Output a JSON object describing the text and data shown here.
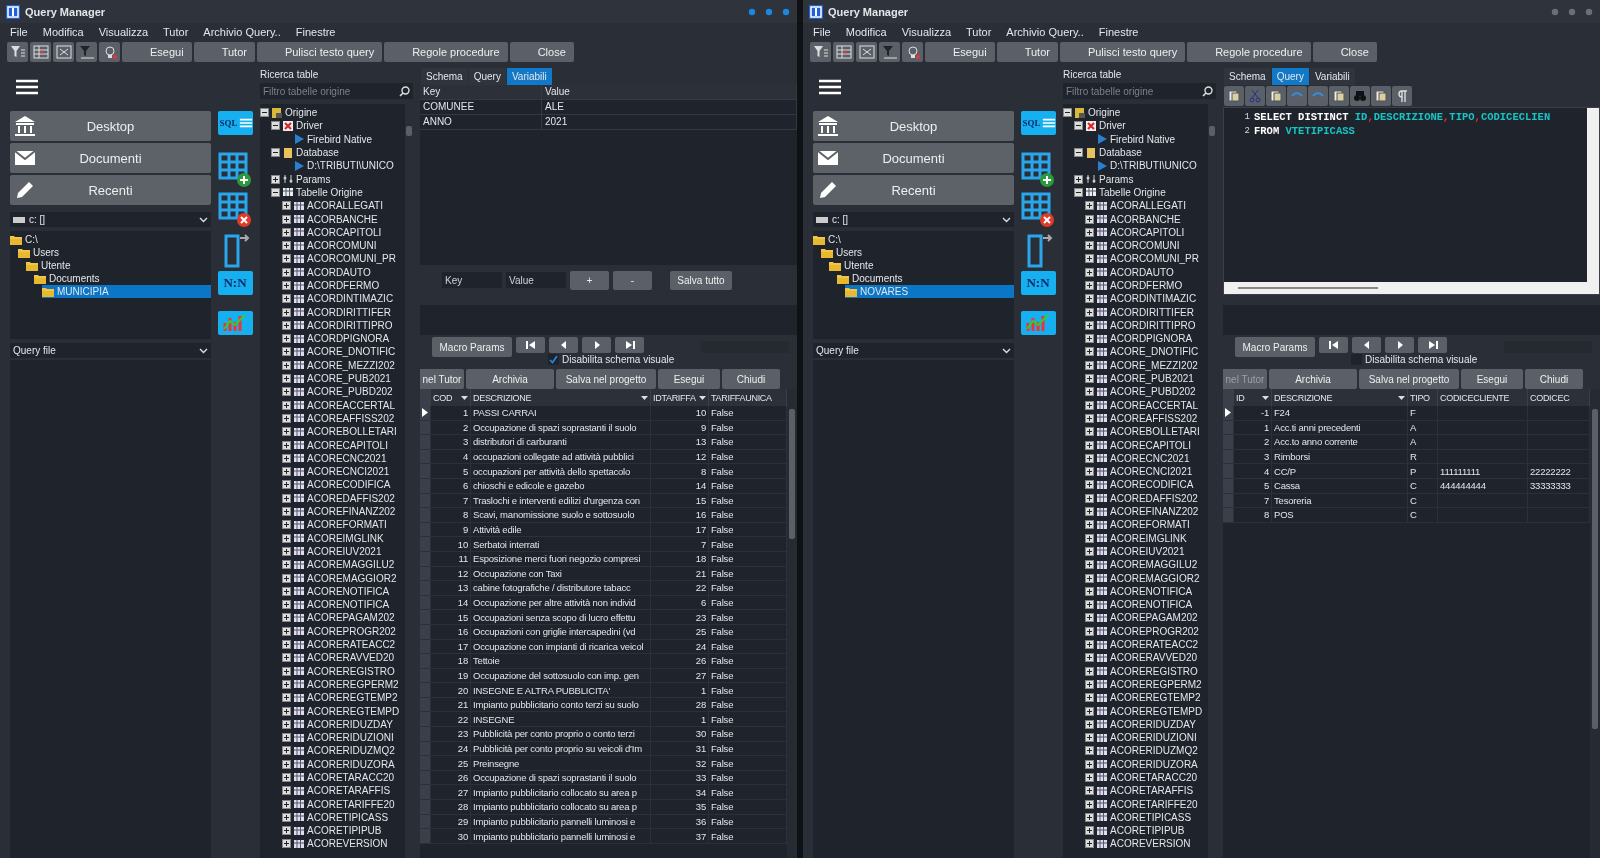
{
  "windows": [
    {
      "title": "Query Manager",
      "active": true,
      "menu": [
        "File",
        "Modifica",
        "Visualizza",
        "Tutor",
        "Archivio Query..",
        "Finestre"
      ],
      "toolbar": [
        {
          "kind": "icon"
        },
        {
          "kind": "icon"
        },
        {
          "kind": "icon"
        },
        {
          "kind": "icon"
        },
        {
          "kind": "icon"
        },
        {
          "kind": "text",
          "label": "Esegui"
        },
        {
          "kind": "text",
          "label": "Tutor"
        },
        {
          "kind": "text",
          "label": "Pulisci testo query"
        },
        {
          "kind": "text",
          "label": "Regole procedure"
        },
        {
          "kind": "text",
          "label": "Close"
        }
      ],
      "sidebar": {
        "nav": [
          "Desktop",
          "Documenti",
          "Recenti"
        ],
        "drive": "c: []",
        "folders": [
          {
            "label": "C:\\",
            "selected": false,
            "children": [
              {
                "label": "Users",
                "selected": false,
                "children": [
                  {
                    "label": "Utente",
                    "selected": false,
                    "children": [
                      {
                        "label": "Documents",
                        "selected": false,
                        "children": [
                          {
                            "label": "MUNICIPIA",
                            "selected": true
                          }
                        ]
                      }
                    ]
                  }
                ]
              }
            ]
          }
        ],
        "query_file": "Query file"
      },
      "tools": [
        {
          "kind": "sql",
          "label": "SQL"
        },
        {
          "kind": "table-add"
        },
        {
          "kind": "table-remove"
        },
        {
          "kind": "panel"
        },
        {
          "kind": "nn",
          "label": "N:N"
        },
        {
          "kind": "chart"
        }
      ],
      "tables_panel": {
        "label": "Ricerca table",
        "search": {
          "placeholder": "Filtro tabelle origine"
        },
        "tree": [
          {
            "label": "Origine",
            "kind": "root",
            "expanded": true,
            "children": [
              {
                "label": "Driver",
                "kind": "driver",
                "expanded": true,
                "children": [
                  {
                    "label": "Firebird Native",
                    "kind": "link"
                  }
                ]
              },
              {
                "label": "Database",
                "kind": "database",
                "expanded": true,
                "children": [
                  {
                    "label": "D:\\TRIBUTI\\UNICO",
                    "kind": "link"
                  }
                ]
              },
              {
                "label": "Params",
                "kind": "params",
                "expanded": false
              },
              {
                "label": "Tabelle Origine",
                "kind": "group",
                "expanded": true,
                "children": [
                  {
                    "label": "ACORALLEGATI",
                    "kind": "table",
                    "expanded": false
                  },
                  {
                    "label": "ACORBANCHE",
                    "kind": "table",
                    "expanded": false
                  },
                  {
                    "label": "ACORCAPITOLI",
                    "kind": "table",
                    "expanded": false
                  },
                  {
                    "label": "ACORCOMUNI",
                    "kind": "table",
                    "expanded": false
                  },
                  {
                    "label": "ACORCOMUNI_PR",
                    "kind": "table",
                    "expanded": false
                  },
                  {
                    "label": "ACORDAUTO",
                    "kind": "table",
                    "expanded": false
                  },
                  {
                    "label": "ACORDFERMO",
                    "kind": "table",
                    "expanded": false
                  },
                  {
                    "label": "ACORDINTIMAZIC",
                    "kind": "table",
                    "expanded": false
                  },
                  {
                    "label": "ACORDIRITTIFER",
                    "kind": "table",
                    "expanded": false
                  },
                  {
                    "label": "ACORDIRITTIPRO",
                    "kind": "table",
                    "expanded": false
                  },
                  {
                    "label": "ACORDPIGNORA",
                    "kind": "table",
                    "expanded": false
                  },
                  {
                    "label": "ACORE_DNOTIFIC",
                    "kind": "table",
                    "expanded": false
                  },
                  {
                    "label": "ACORE_MEZZI202",
                    "kind": "table",
                    "expanded": false
                  },
                  {
                    "label": "ACORE_PUB2021",
                    "kind": "table",
                    "expanded": false
                  },
                  {
                    "label": "ACORE_PUBD202",
                    "kind": "table",
                    "expanded": false
                  },
                  {
                    "label": "ACOREACCERTAL",
                    "kind": "table",
                    "expanded": false
                  },
                  {
                    "label": "ACOREAFFISS202",
                    "kind": "table",
                    "expanded": false
                  },
                  {
                    "label": "ACOREBOLLETARI",
                    "kind": "table",
                    "expanded": false
                  },
                  {
                    "label": "ACORECAPITOLI",
                    "kind": "table",
                    "expanded": false
                  },
                  {
                    "label": "ACORECNC2021",
                    "kind": "table",
                    "expanded": false
                  },
                  {
                    "label": "ACORECNCI2021",
                    "kind": "table",
                    "expanded": false
                  },
                  {
                    "label": "ACORECODIFICA",
                    "kind": "table",
                    "expanded": false
                  },
                  {
                    "label": "ACOREDAFFIS202",
                    "kind": "table",
                    "expanded": false
                  },
                  {
                    "label": "ACOREFINANZ202",
                    "kind": "table",
                    "expanded": false
                  },
                  {
                    "label": "ACOREFORMATI",
                    "kind": "table",
                    "expanded": false
                  },
                  {
                    "label": "ACOREIMGLINK",
                    "kind": "table",
                    "expanded": false
                  },
                  {
                    "label": "ACOREIUV2021",
                    "kind": "table",
                    "expanded": false
                  },
                  {
                    "label": "ACOREMAGGILU2",
                    "kind": "table",
                    "expanded": false
                  },
                  {
                    "label": "ACOREMAGGIOR2",
                    "kind": "table",
                    "expanded": false
                  },
                  {
                    "label": "ACORENOTIFICA",
                    "kind": "table",
                    "expanded": false
                  },
                  {
                    "label": "ACORENOTIFICA",
                    "kind": "table",
                    "expanded": false
                  },
                  {
                    "label": "ACOREPAGAM202",
                    "kind": "table",
                    "expanded": false
                  },
                  {
                    "label": "ACOREPROGR202",
                    "kind": "table",
                    "expanded": false
                  },
                  {
                    "label": "ACORERATEACC2",
                    "kind": "table",
                    "expanded": false
                  },
                  {
                    "label": "ACORERAVVED20",
                    "kind": "table",
                    "expanded": false
                  },
                  {
                    "label": "ACOREREGISTRO",
                    "kind": "table",
                    "expanded": false
                  },
                  {
                    "label": "ACOREREGPERM2",
                    "kind": "table",
                    "expanded": false
                  },
                  {
                    "label": "ACOREREGTEMP2",
                    "kind": "table",
                    "expanded": false
                  },
                  {
                    "label": "ACOREREGTEMPD",
                    "kind": "table",
                    "expanded": false
                  },
                  {
                    "label": "ACORERIDUZDAY",
                    "kind": "table",
                    "expanded": false
                  },
                  {
                    "label": "ACORERIDUZIONI",
                    "kind": "table",
                    "expanded": false
                  },
                  {
                    "label": "ACORERIDUZMQ2",
                    "kind": "table",
                    "expanded": false
                  },
                  {
                    "label": "ACORERIDUZORA",
                    "kind": "table",
                    "expanded": false
                  },
                  {
                    "label": "ACORETARACC20",
                    "kind": "table",
                    "expanded": false
                  },
                  {
                    "label": "ACORETARAFFIS",
                    "kind": "table",
                    "expanded": false
                  },
                  {
                    "label": "ACORETARIFFE20",
                    "kind": "table",
                    "expanded": false
                  },
                  {
                    "label": "ACORETIPICASS",
                    "kind": "table",
                    "expanded": false
                  },
                  {
                    "label": "ACORETIPIPUB",
                    "kind": "table",
                    "expanded": false
                  },
                  {
                    "label": "ACOREVERSION",
                    "kind": "table",
                    "expanded": false
                  }
                ]
              }
            ]
          }
        ]
      },
      "tabs": [
        {
          "label": "Schema",
          "kind": "schema",
          "selected": false
        },
        {
          "label": "Query",
          "kind": "query",
          "selected": false
        },
        {
          "label": "Variabili",
          "kind": "variables",
          "selected": true
        }
      ],
      "variables": {
        "columns": [
          "Key",
          "Value"
        ],
        "rows": [
          [
            "COMUNEE",
            "ALE"
          ],
          [
            "ANNO",
            "2021"
          ]
        ],
        "key_field": {
          "placeholder": "Key"
        },
        "value_field": {
          "placeholder": "Value"
        },
        "buttons": [
          "+",
          "-",
          "Salva tutto"
        ]
      },
      "macro_button": "Macro Params",
      "checkbox": {
        "label": "Disabilita schema visuale",
        "checked": true
      },
      "actions": [
        {
          "label": "nel Tutor",
          "disabled": false
        },
        {
          "label": "Archivia",
          "disabled": false
        },
        {
          "label": "Salva nel progetto",
          "disabled": false
        },
        {
          "label": "Esegui",
          "disabled": false
        },
        {
          "label": "Chiudi",
          "disabled": false
        }
      ],
      "table": {
        "columns": [
          {
            "label": "COD",
            "kind": "number",
            "dropdown": true
          },
          {
            "label": "DESCRIZIONE",
            "kind": "text",
            "dropdown": true
          },
          {
            "label": "IDTARIFFA",
            "kind": "number",
            "dropdown": true
          },
          {
            "label": "TARIFFAUNICA",
            "kind": "text",
            "dropdown": false
          }
        ],
        "rows": [
          {
            "current": true,
            "cells": [
              "1",
              "PASSI CARRAI",
              "10",
              "False"
            ]
          },
          {
            "current": false,
            "cells": [
              "2",
              "Occupazione di spazi soprastanti il suolo",
              "9",
              "False"
            ]
          },
          {
            "current": false,
            "cells": [
              "3",
              "distributori di carburanti",
              "13",
              "False"
            ]
          },
          {
            "current": false,
            "cells": [
              "4",
              "occupazioni collegate ad attività pubblici",
              "12",
              "False"
            ]
          },
          {
            "current": false,
            "cells": [
              "5",
              "occupazioni per attività dello spettacolo",
              "8",
              "False"
            ]
          },
          {
            "current": false,
            "cells": [
              "6",
              "chioschi e edicole e gazebo",
              "14",
              "False"
            ]
          },
          {
            "current": false,
            "cells": [
              "7",
              "Traslochi e interventi edilizi d'urgenza con",
              "15",
              "False"
            ]
          },
          {
            "current": false,
            "cells": [
              "8",
              "Scavi, manomissione suolo e sottosuolo",
              "16",
              "False"
            ]
          },
          {
            "current": false,
            "cells": [
              "9",
              "Attività edile",
              "17",
              "False"
            ]
          },
          {
            "current": false,
            "cells": [
              "10",
              "Serbatoi interrati",
              "7",
              "False"
            ]
          },
          {
            "current": false,
            "cells": [
              "11",
              "Esposizione merci fuori negozio compresi",
              "18",
              "False"
            ]
          },
          {
            "current": false,
            "cells": [
              "12",
              "Occupazione con Taxi",
              "21",
              "False"
            ]
          },
          {
            "current": false,
            "cells": [
              "13",
              "cabine fotografiche / distributore tabacc",
              "22",
              "False"
            ]
          },
          {
            "current": false,
            "cells": [
              "14",
              "Occupazione per altre attività non individ",
              "6",
              "False"
            ]
          },
          {
            "current": false,
            "cells": [
              "15",
              "Occupazioni senza scopo di lucro effettu",
              "23",
              "False"
            ]
          },
          {
            "current": false,
            "cells": [
              "16",
              "Occupazioni con griglie intercapedini (vd",
              "25",
              "False"
            ]
          },
          {
            "current": false,
            "cells": [
              "17",
              "Occupazione con impianti di ricarica veicol",
              "24",
              "False"
            ]
          },
          {
            "current": false,
            "cells": [
              "18",
              "Tettoie",
              "26",
              "False"
            ]
          },
          {
            "current": false,
            "cells": [
              "19",
              "Occupazione del sottosuolo con imp. gen",
              "27",
              "False"
            ]
          },
          {
            "current": false,
            "cells": [
              "20",
              "INSEGNE E ALTRA PUBBLICITA'",
              "1",
              "False"
            ]
          },
          {
            "current": false,
            "cells": [
              "21",
              "Impianto pubblicitario conto terzi su suolo",
              "28",
              "False"
            ]
          },
          {
            "current": false,
            "cells": [
              "22",
              "INSEGNE",
              "1",
              "False"
            ]
          },
          {
            "current": false,
            "cells": [
              "23",
              "Pubblicità per conto proprio o conto terzi",
              "30",
              "False"
            ]
          },
          {
            "current": false,
            "cells": [
              "24",
              "Pubblicità per conto proprio su veicoli d'Im",
              "31",
              "False"
            ]
          },
          {
            "current": false,
            "cells": [
              "25",
              "Preinsegne",
              "32",
              "False"
            ]
          },
          {
            "current": false,
            "cells": [
              "26",
              "Occupazione di spazi soprastanti il suolo",
              "33",
              "False"
            ]
          },
          {
            "current": false,
            "cells": [
              "27",
              "Impianto pubblicitario collocato su area p",
              "34",
              "False"
            ]
          },
          {
            "current": false,
            "cells": [
              "28",
              "Impianto pubblicitario collocato su area p",
              "35",
              "False"
            ]
          },
          {
            "current": false,
            "cells": [
              "29",
              "Impianto pubblicitario pannelli luminosi e",
              "36",
              "False"
            ]
          },
          {
            "current": false,
            "cells": [
              "30",
              "Impianto pubblicitario pannelli luminosi e",
              "37",
              "False"
            ]
          }
        ]
      }
    },
    {
      "title": "Query Manager",
      "active": false,
      "menu": [
        "File",
        "Modifica",
        "Visualizza",
        "Tutor",
        "Archivio Query..",
        "Finestre"
      ],
      "toolbar": [
        {
          "kind": "icon"
        },
        {
          "kind": "icon"
        },
        {
          "kind": "icon"
        },
        {
          "kind": "icon"
        },
        {
          "kind": "icon"
        },
        {
          "kind": "text",
          "label": "Esegui"
        },
        {
          "kind": "text",
          "label": "Tutor"
        },
        {
          "kind": "text",
          "label": "Pulisci testo query"
        },
        {
          "kind": "text",
          "label": "Regole procedure"
        },
        {
          "kind": "text",
          "label": "Close"
        }
      ],
      "sidebar": {
        "nav": [
          "Desktop",
          "Documenti",
          "Recenti"
        ],
        "drive": "c: []",
        "folders": [
          {
            "label": "C:\\",
            "selected": false,
            "children": [
              {
                "label": "Users",
                "selected": false,
                "children": [
                  {
                    "label": "Utente",
                    "selected": false,
                    "children": [
                      {
                        "label": "Documents",
                        "selected": false,
                        "children": [
                          {
                            "label": "NOVARES",
                            "selected": true
                          }
                        ]
                      }
                    ]
                  }
                ]
              }
            ]
          }
        ],
        "query_file": "Query file"
      },
      "tools": [
        {
          "kind": "sql",
          "label": "SQL"
        },
        {
          "kind": "table-add"
        },
        {
          "kind": "table-remove"
        },
        {
          "kind": "panel"
        },
        {
          "kind": "nn",
          "label": "N:N"
        },
        {
          "kind": "chart"
        }
      ],
      "tables_panel": {
        "label": "Ricerca table",
        "search": {
          "placeholder": "Filtro tabelle origine"
        },
        "tree": [
          {
            "label": "Origine",
            "kind": "root",
            "expanded": true,
            "children": [
              {
                "label": "Driver",
                "kind": "driver",
                "expanded": true,
                "children": [
                  {
                    "label": "Firebird Native",
                    "kind": "link"
                  }
                ]
              },
              {
                "label": "Database",
                "kind": "database",
                "expanded": true,
                "children": [
                  {
                    "label": "D:\\TRIBUTI\\UNICO",
                    "kind": "link"
                  }
                ]
              },
              {
                "label": "Params",
                "kind": "params",
                "expanded": false
              },
              {
                "label": "Tabelle Origine",
                "kind": "group",
                "expanded": true,
                "children": [
                  {
                    "label": "ACORALLEGATI",
                    "kind": "table",
                    "expanded": false
                  },
                  {
                    "label": "ACORBANCHE",
                    "kind": "table",
                    "expanded": false
                  },
                  {
                    "label": "ACORCAPITOLI",
                    "kind": "table",
                    "expanded": false
                  },
                  {
                    "label": "ACORCOMUNI",
                    "kind": "table",
                    "expanded": false
                  },
                  {
                    "label": "ACORCOMUNI_PR",
                    "kind": "table",
                    "expanded": false
                  },
                  {
                    "label": "ACORDAUTO",
                    "kind": "table",
                    "expanded": false
                  },
                  {
                    "label": "ACORDFERMO",
                    "kind": "table",
                    "expanded": false
                  },
                  {
                    "label": "ACORDINTIMAZIC",
                    "kind": "table",
                    "expanded": false
                  },
                  {
                    "label": "ACORDIRITTIFER",
                    "kind": "table",
                    "expanded": false
                  },
                  {
                    "label": "ACORDIRITTIPRO",
                    "kind": "table",
                    "expanded": false
                  },
                  {
                    "label": "ACORDPIGNORA",
                    "kind": "table",
                    "expanded": false
                  },
                  {
                    "label": "ACORE_DNOTIFIC",
                    "kind": "table",
                    "expanded": false
                  },
                  {
                    "label": "ACORE_MEZZI202",
                    "kind": "table",
                    "expanded": false
                  },
                  {
                    "label": "ACORE_PUB2021",
                    "kind": "table",
                    "expanded": false
                  },
                  {
                    "label": "ACORE_PUBD202",
                    "kind": "table",
                    "expanded": false
                  },
                  {
                    "label": "ACOREACCERTAL",
                    "kind": "table",
                    "expanded": false
                  },
                  {
                    "label": "ACOREAFFISS202",
                    "kind": "table",
                    "expanded": false
                  },
                  {
                    "label": "ACOREBOLLETARI",
                    "kind": "table",
                    "expanded": false
                  },
                  {
                    "label": "ACORECAPITOLI",
                    "kind": "table",
                    "expanded": false
                  },
                  {
                    "label": "ACORECNC2021",
                    "kind": "table",
                    "expanded": false
                  },
                  {
                    "label": "ACORECNCI2021",
                    "kind": "table",
                    "expanded": false
                  },
                  {
                    "label": "ACORECODIFICA",
                    "kind": "table",
                    "expanded": false
                  },
                  {
                    "label": "ACOREDAFFIS202",
                    "kind": "table",
                    "expanded": false
                  },
                  {
                    "label": "ACOREFINANZ202",
                    "kind": "table",
                    "expanded": false
                  },
                  {
                    "label": "ACOREFORMATI",
                    "kind": "table",
                    "expanded": false
                  },
                  {
                    "label": "ACOREIMGLINK",
                    "kind": "table",
                    "expanded": false
                  },
                  {
                    "label": "ACOREIUV2021",
                    "kind": "table",
                    "expanded": false
                  },
                  {
                    "label": "ACOREMAGGILU2",
                    "kind": "table",
                    "expanded": false
                  },
                  {
                    "label": "ACOREMAGGIOR2",
                    "kind": "table",
                    "expanded": false
                  },
                  {
                    "label": "ACORENOTIFICA",
                    "kind": "table",
                    "expanded": false
                  },
                  {
                    "label": "ACORENOTIFICA",
                    "kind": "table",
                    "expanded": false
                  },
                  {
                    "label": "ACOREPAGAM202",
                    "kind": "table",
                    "expanded": false
                  },
                  {
                    "label": "ACOREPROGR202",
                    "kind": "table",
                    "expanded": false
                  },
                  {
                    "label": "ACORERATEACC2",
                    "kind": "table",
                    "expanded": false
                  },
                  {
                    "label": "ACORERAVVED20",
                    "kind": "table",
                    "expanded": false
                  },
                  {
                    "label": "ACOREREGISTRO",
                    "kind": "table",
                    "expanded": false
                  },
                  {
                    "label": "ACOREREGPERM2",
                    "kind": "table",
                    "expanded": false
                  },
                  {
                    "label": "ACOREREGTEMP2",
                    "kind": "table",
                    "expanded": false
                  },
                  {
                    "label": "ACOREREGTEMPD",
                    "kind": "table",
                    "expanded": false
                  },
                  {
                    "label": "ACORERIDUZDAY",
                    "kind": "table",
                    "expanded": false
                  },
                  {
                    "label": "ACORERIDUZIONI",
                    "kind": "table",
                    "expanded": false
                  },
                  {
                    "label": "ACORERIDUZMQ2",
                    "kind": "table",
                    "expanded": false
                  },
                  {
                    "label": "ACORERIDUZORA",
                    "kind": "table",
                    "expanded": false
                  },
                  {
                    "label": "ACORETARACC20",
                    "kind": "table",
                    "expanded": false
                  },
                  {
                    "label": "ACORETARAFFIS",
                    "kind": "table",
                    "expanded": false
                  },
                  {
                    "label": "ACORETARIFFE20",
                    "kind": "table",
                    "expanded": false
                  },
                  {
                    "label": "ACORETIPICASS",
                    "kind": "table",
                    "expanded": false
                  },
                  {
                    "label": "ACORETIPIPUB",
                    "kind": "table",
                    "expanded": false
                  },
                  {
                    "label": "ACOREVERSION",
                    "kind": "table",
                    "expanded": false
                  }
                ]
              }
            ]
          }
        ]
      },
      "tabs": [
        {
          "label": "Schema",
          "kind": "schema",
          "selected": false
        },
        {
          "label": "Query",
          "kind": "query",
          "selected": true
        },
        {
          "label": "Variabili",
          "kind": "variables",
          "selected": false
        }
      ],
      "editor": {
        "lines": [
          {
            "number": "1",
            "tokens": [
              {
                "kind": "keyword",
                "text": "SELECT DISTINCT"
              },
              {
                "kind": "identifier",
                "text": "ID"
              },
              {
                "kind": "punct",
                "text": ","
              },
              {
                "kind": "identifier",
                "text": "DESCRIZIONE"
              },
              {
                "kind": "punct",
                "text": ","
              },
              {
                "kind": "identifier",
                "text": "TIPO"
              },
              {
                "kind": "punct",
                "text": ","
              },
              {
                "kind": "identifier",
                "text": "CODICECLIEN"
              }
            ]
          },
          {
            "number": "2",
            "tokens": [
              {
                "kind": "keyword",
                "text": "FROM"
              },
              {
                "kind": "identifier",
                "text": "VTETIPICASS"
              }
            ]
          }
        ]
      },
      "macro_button": "Macro Params",
      "checkbox": {
        "label": "Disabilita schema visuale",
        "checked": false
      },
      "actions": [
        {
          "label": "nel Tutor",
          "disabled": true
        },
        {
          "label": "Archivia",
          "disabled": false
        },
        {
          "label": "Salva nel progetto",
          "disabled": false
        },
        {
          "label": "Esegui",
          "disabled": false
        },
        {
          "label": "Chiudi",
          "disabled": false
        }
      ],
      "table": {
        "columns": [
          {
            "label": "ID",
            "kind": "number",
            "dropdown": true
          },
          {
            "label": "DESCRIZIONE",
            "kind": "text",
            "dropdown": true
          },
          {
            "label": "TIPO",
            "kind": "text",
            "dropdown": false
          },
          {
            "label": "CODICECLIENTE",
            "kind": "text",
            "dropdown": false
          },
          {
            "label": "CODICEC",
            "kind": "text",
            "dropdown": false
          }
        ],
        "rows": [
          {
            "current": true,
            "cells": [
              "-1",
              "F24",
              "F",
              "",
              ""
            ]
          },
          {
            "current": false,
            "cells": [
              "1",
              "Acc.ti anni precedenti",
              "A",
              "",
              ""
            ]
          },
          {
            "current": false,
            "cells": [
              "2",
              "Acc.to anno corrente",
              "A",
              "",
              ""
            ]
          },
          {
            "current": false,
            "cells": [
              "3",
              "Rimborsi",
              "R",
              "",
              ""
            ]
          },
          {
            "current": false,
            "cells": [
              "4",
              "CC/P",
              "P",
              "111111111",
              "22222222"
            ]
          },
          {
            "current": false,
            "cells": [
              "5",
              "Cassa",
              "C",
              "444444444",
              "33333333"
            ]
          },
          {
            "current": false,
            "cells": [
              "7",
              "Tesoreria",
              "C",
              "",
              ""
            ]
          },
          {
            "current": false,
            "cells": [
              "8",
              "POS",
              "C",
              "",
              ""
            ]
          }
        ]
      }
    }
  ]
}
